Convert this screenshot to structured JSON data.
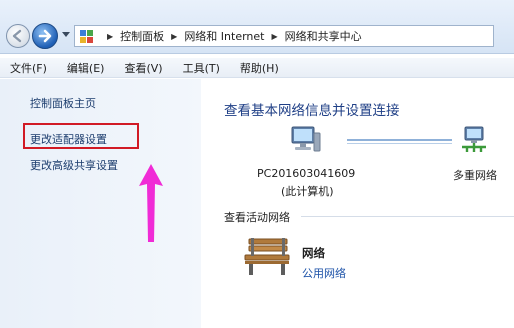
{
  "address_bar": {
    "breadcrumbs": [
      "控制面板",
      "网络和 Internet",
      "网络和共享中心"
    ]
  },
  "menu": [
    "文件(F)",
    "编辑(E)",
    "查看(V)",
    "工具(T)",
    "帮助(H)"
  ],
  "sidebar": {
    "home": "控制面板主页",
    "adapter": "更改适配器设置",
    "advanced_sharing": "更改高级共享设置"
  },
  "main": {
    "heading": "查看基本网络信息并设置连接",
    "computer_name": "PC201603041609",
    "computer_sub": "(此计算机)",
    "multiple_networks": "多重网络",
    "active_networks_label": "查看活动网络",
    "network_name": "网络",
    "network_type": "公用网络"
  },
  "colors": {
    "highlight_box": "#d11a25",
    "annotation_arrow": "#f02bd6",
    "link": "#1c3d6e"
  }
}
